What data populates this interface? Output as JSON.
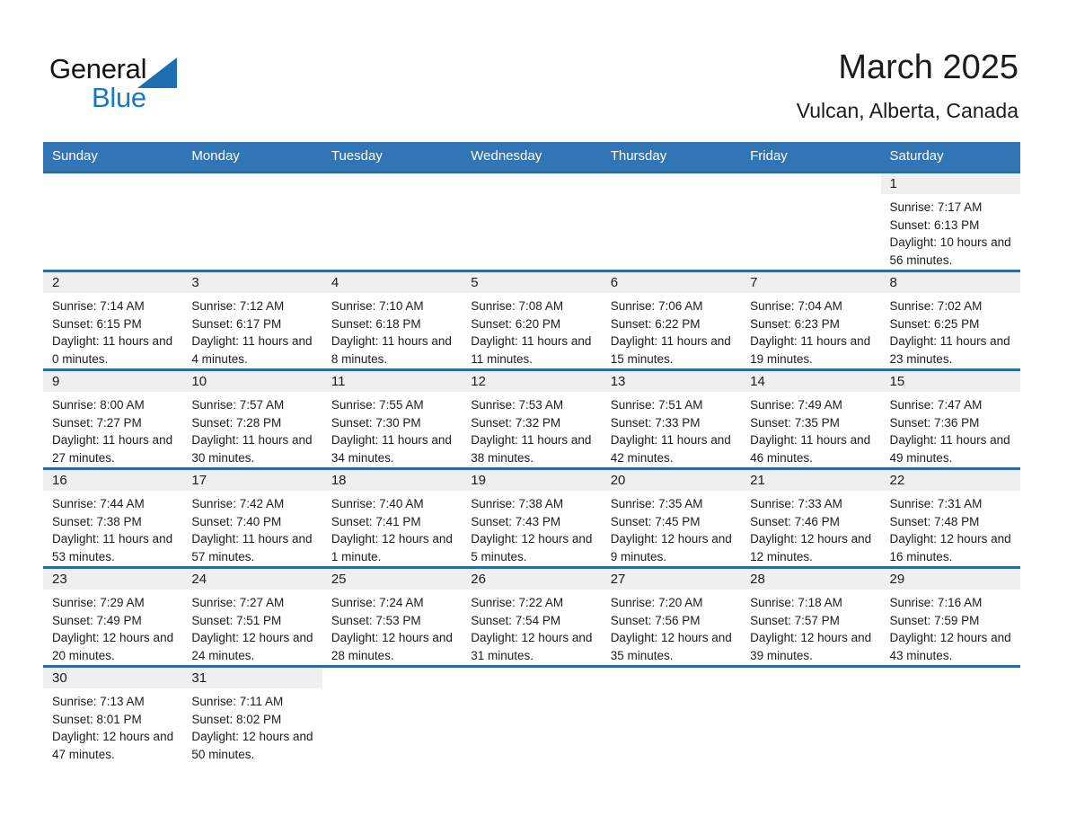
{
  "brand": {
    "name_part1": "General",
    "name_part2": "Blue",
    "triangle_color": "#1b6eb0",
    "blue_color": "#1878c8"
  },
  "header": {
    "title": "March 2025",
    "location": "Vulcan, Alberta, Canada"
  },
  "theme": {
    "header_row_bg": "#3175b4",
    "row_border": "#2b6ca8",
    "daynum_bg": "#efefef",
    "text": "#1c1c1c"
  },
  "weekday_headers": [
    "Sunday",
    "Monday",
    "Tuesday",
    "Wednesday",
    "Thursday",
    "Friday",
    "Saturday"
  ],
  "labels": {
    "sunrise": "Sunrise:",
    "sunset": "Sunset:",
    "daylight": "Daylight:"
  },
  "weeks": [
    [
      {
        "day": ""
      },
      {
        "day": ""
      },
      {
        "day": ""
      },
      {
        "day": ""
      },
      {
        "day": ""
      },
      {
        "day": ""
      },
      {
        "day": "1",
        "sunrise": "Sunrise: 7:17 AM",
        "sunset": "Sunset: 6:13 PM",
        "daylight": "Daylight: 10 hours and 56 minutes."
      }
    ],
    [
      {
        "day": "2",
        "sunrise": "Sunrise: 7:14 AM",
        "sunset": "Sunset: 6:15 PM",
        "daylight": "Daylight: 11 hours and 0 minutes."
      },
      {
        "day": "3",
        "sunrise": "Sunrise: 7:12 AM",
        "sunset": "Sunset: 6:17 PM",
        "daylight": "Daylight: 11 hours and 4 minutes."
      },
      {
        "day": "4",
        "sunrise": "Sunrise: 7:10 AM",
        "sunset": "Sunset: 6:18 PM",
        "daylight": "Daylight: 11 hours and 8 minutes."
      },
      {
        "day": "5",
        "sunrise": "Sunrise: 7:08 AM",
        "sunset": "Sunset: 6:20 PM",
        "daylight": "Daylight: 11 hours and 11 minutes."
      },
      {
        "day": "6",
        "sunrise": "Sunrise: 7:06 AM",
        "sunset": "Sunset: 6:22 PM",
        "daylight": "Daylight: 11 hours and 15 minutes."
      },
      {
        "day": "7",
        "sunrise": "Sunrise: 7:04 AM",
        "sunset": "Sunset: 6:23 PM",
        "daylight": "Daylight: 11 hours and 19 minutes."
      },
      {
        "day": "8",
        "sunrise": "Sunrise: 7:02 AM",
        "sunset": "Sunset: 6:25 PM",
        "daylight": "Daylight: 11 hours and 23 minutes."
      }
    ],
    [
      {
        "day": "9",
        "sunrise": "Sunrise: 8:00 AM",
        "sunset": "Sunset: 7:27 PM",
        "daylight": "Daylight: 11 hours and 27 minutes."
      },
      {
        "day": "10",
        "sunrise": "Sunrise: 7:57 AM",
        "sunset": "Sunset: 7:28 PM",
        "daylight": "Daylight: 11 hours and 30 minutes."
      },
      {
        "day": "11",
        "sunrise": "Sunrise: 7:55 AM",
        "sunset": "Sunset: 7:30 PM",
        "daylight": "Daylight: 11 hours and 34 minutes."
      },
      {
        "day": "12",
        "sunrise": "Sunrise: 7:53 AM",
        "sunset": "Sunset: 7:32 PM",
        "daylight": "Daylight: 11 hours and 38 minutes."
      },
      {
        "day": "13",
        "sunrise": "Sunrise: 7:51 AM",
        "sunset": "Sunset: 7:33 PM",
        "daylight": "Daylight: 11 hours and 42 minutes."
      },
      {
        "day": "14",
        "sunrise": "Sunrise: 7:49 AM",
        "sunset": "Sunset: 7:35 PM",
        "daylight": "Daylight: 11 hours and 46 minutes."
      },
      {
        "day": "15",
        "sunrise": "Sunrise: 7:47 AM",
        "sunset": "Sunset: 7:36 PM",
        "daylight": "Daylight: 11 hours and 49 minutes."
      }
    ],
    [
      {
        "day": "16",
        "sunrise": "Sunrise: 7:44 AM",
        "sunset": "Sunset: 7:38 PM",
        "daylight": "Daylight: 11 hours and 53 minutes."
      },
      {
        "day": "17",
        "sunrise": "Sunrise: 7:42 AM",
        "sunset": "Sunset: 7:40 PM",
        "daylight": "Daylight: 11 hours and 57 minutes."
      },
      {
        "day": "18",
        "sunrise": "Sunrise: 7:40 AM",
        "sunset": "Sunset: 7:41 PM",
        "daylight": "Daylight: 12 hours and 1 minute."
      },
      {
        "day": "19",
        "sunrise": "Sunrise: 7:38 AM",
        "sunset": "Sunset: 7:43 PM",
        "daylight": "Daylight: 12 hours and 5 minutes."
      },
      {
        "day": "20",
        "sunrise": "Sunrise: 7:35 AM",
        "sunset": "Sunset: 7:45 PM",
        "daylight": "Daylight: 12 hours and 9 minutes."
      },
      {
        "day": "21",
        "sunrise": "Sunrise: 7:33 AM",
        "sunset": "Sunset: 7:46 PM",
        "daylight": "Daylight: 12 hours and 12 minutes."
      },
      {
        "day": "22",
        "sunrise": "Sunrise: 7:31 AM",
        "sunset": "Sunset: 7:48 PM",
        "daylight": "Daylight: 12 hours and 16 minutes."
      }
    ],
    [
      {
        "day": "23",
        "sunrise": "Sunrise: 7:29 AM",
        "sunset": "Sunset: 7:49 PM",
        "daylight": "Daylight: 12 hours and 20 minutes."
      },
      {
        "day": "24",
        "sunrise": "Sunrise: 7:27 AM",
        "sunset": "Sunset: 7:51 PM",
        "daylight": "Daylight: 12 hours and 24 minutes."
      },
      {
        "day": "25",
        "sunrise": "Sunrise: 7:24 AM",
        "sunset": "Sunset: 7:53 PM",
        "daylight": "Daylight: 12 hours and 28 minutes."
      },
      {
        "day": "26",
        "sunrise": "Sunrise: 7:22 AM",
        "sunset": "Sunset: 7:54 PM",
        "daylight": "Daylight: 12 hours and 31 minutes."
      },
      {
        "day": "27",
        "sunrise": "Sunrise: 7:20 AM",
        "sunset": "Sunset: 7:56 PM",
        "daylight": "Daylight: 12 hours and 35 minutes."
      },
      {
        "day": "28",
        "sunrise": "Sunrise: 7:18 AM",
        "sunset": "Sunset: 7:57 PM",
        "daylight": "Daylight: 12 hours and 39 minutes."
      },
      {
        "day": "29",
        "sunrise": "Sunrise: 7:16 AM",
        "sunset": "Sunset: 7:59 PM",
        "daylight": "Daylight: 12 hours and 43 minutes."
      }
    ],
    [
      {
        "day": "30",
        "sunrise": "Sunrise: 7:13 AM",
        "sunset": "Sunset: 8:01 PM",
        "daylight": "Daylight: 12 hours and 47 minutes."
      },
      {
        "day": "31",
        "sunrise": "Sunrise: 7:11 AM",
        "sunset": "Sunset: 8:02 PM",
        "daylight": "Daylight: 12 hours and 50 minutes."
      },
      {
        "day": ""
      },
      {
        "day": ""
      },
      {
        "day": ""
      },
      {
        "day": ""
      },
      {
        "day": ""
      }
    ]
  ]
}
